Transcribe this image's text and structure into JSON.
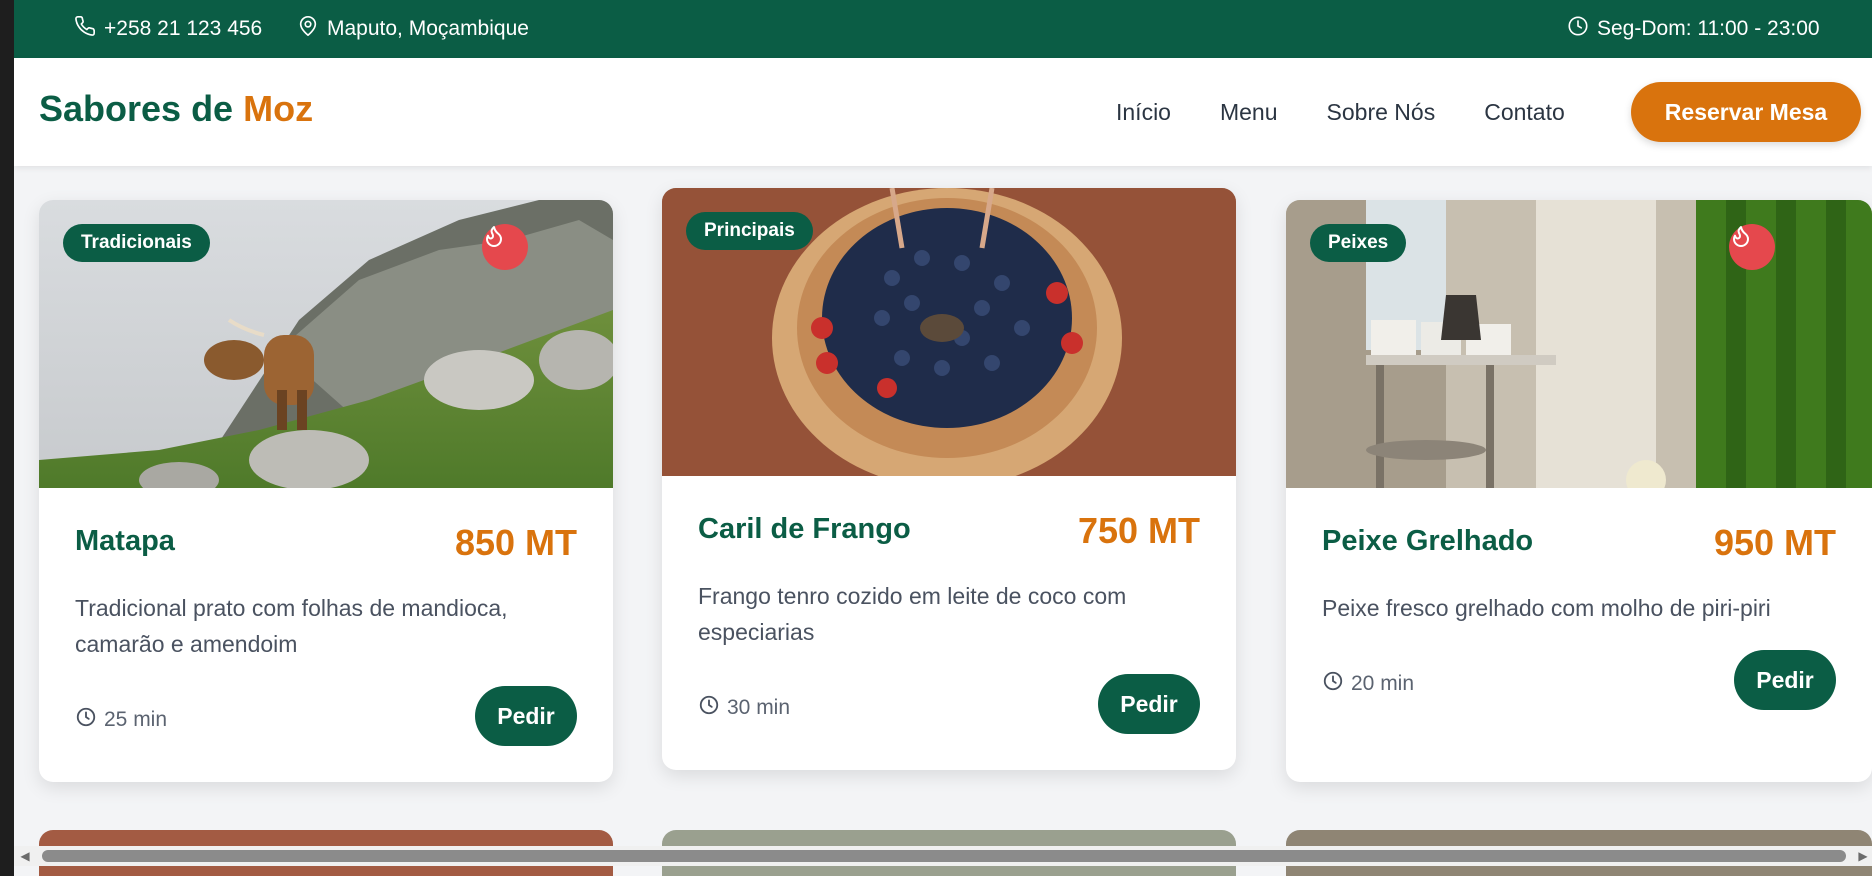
{
  "topbar": {
    "phone": "+258 21 123 456",
    "location": "Maputo, Moçambique",
    "hours": "Seg-Dom: 11:00 - 23:00"
  },
  "brand": {
    "name_part1": "Sabores de",
    "name_part2": "Moz"
  },
  "nav": {
    "links": [
      "Início",
      "Menu",
      "Sobre Nós",
      "Contato"
    ],
    "cta": "Reservar Mesa"
  },
  "dishes": [
    {
      "category": "Tradicionais",
      "name": "Matapa",
      "price": "850 MT",
      "description": "Tradicional prato com folhas de mandioca, camarão e amendoim",
      "time": "25 min",
      "order_label": "Pedir",
      "spicy": true
    },
    {
      "category": "Principais",
      "name": "Caril de Frango",
      "price": "750 MT",
      "description": "Frango tenro cozido em leite de coco com especiarias",
      "time": "30 min",
      "order_label": "Pedir",
      "spicy": false
    },
    {
      "category": "Peixes",
      "name": "Peixe Grelhado",
      "price": "950 MT",
      "description": "Peixe fresco grelhado com molho de piri-piri",
      "time": "20 min",
      "order_label": "Pedir",
      "spicy": true
    }
  ],
  "icons": {
    "phone": "phone-icon",
    "location": "map-pin-icon",
    "hours": "clock-icon",
    "spicy": "flame-icon",
    "time": "clock-icon"
  },
  "colors": {
    "primary": "#0b5d45",
    "accent": "#d9730d",
    "spicy": "#e5484d"
  }
}
